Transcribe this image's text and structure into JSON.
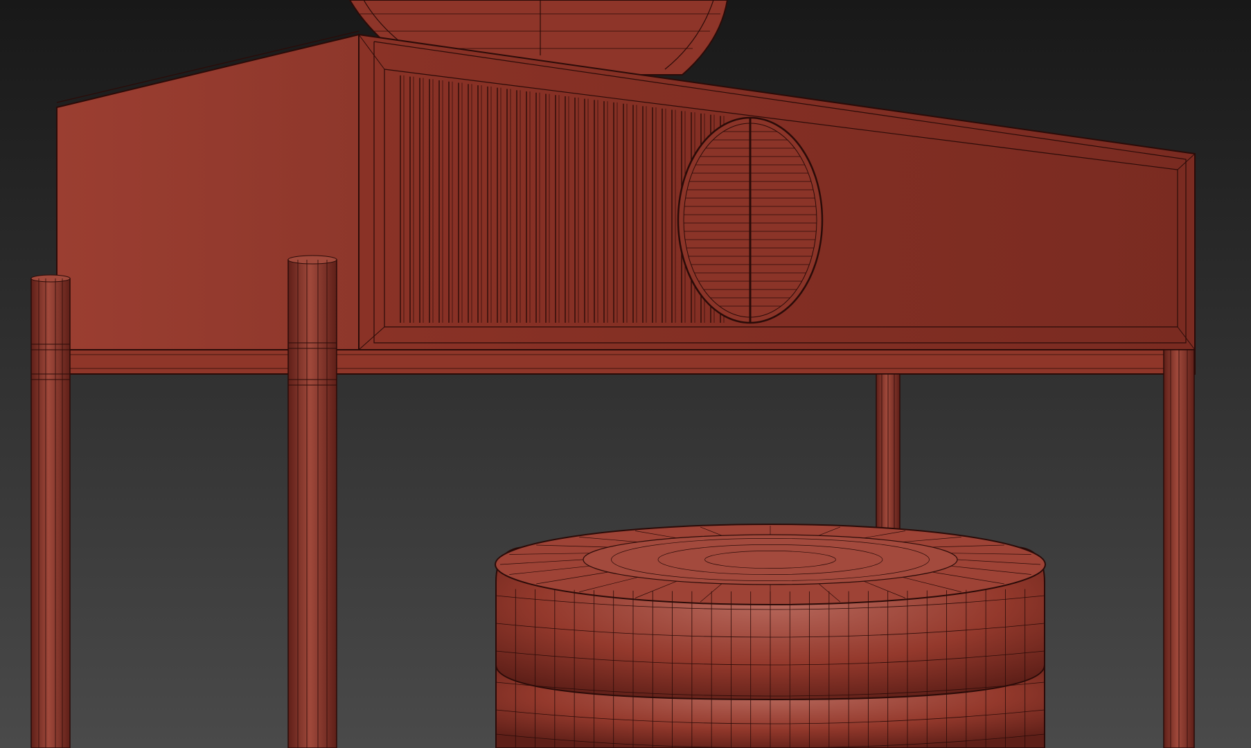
{
  "scene": {
    "kind": "3d-viewport-wireframe-render",
    "subject": "vanity-table-with-round-mirror-and-ottoman",
    "colors": {
      "background_top": "#181818",
      "background_bottom": "#4a4a4a",
      "material_base": "#8c3428",
      "material_light": "#a2483a",
      "material_dark": "#5e1f18",
      "wire": "#2a0b08"
    },
    "objects": [
      "round-mirror",
      "table-top-box",
      "fluted-drawer-front",
      "drawer-round-handle",
      "table-frame-rail",
      "table-legs",
      "round-ottoman"
    ]
  }
}
